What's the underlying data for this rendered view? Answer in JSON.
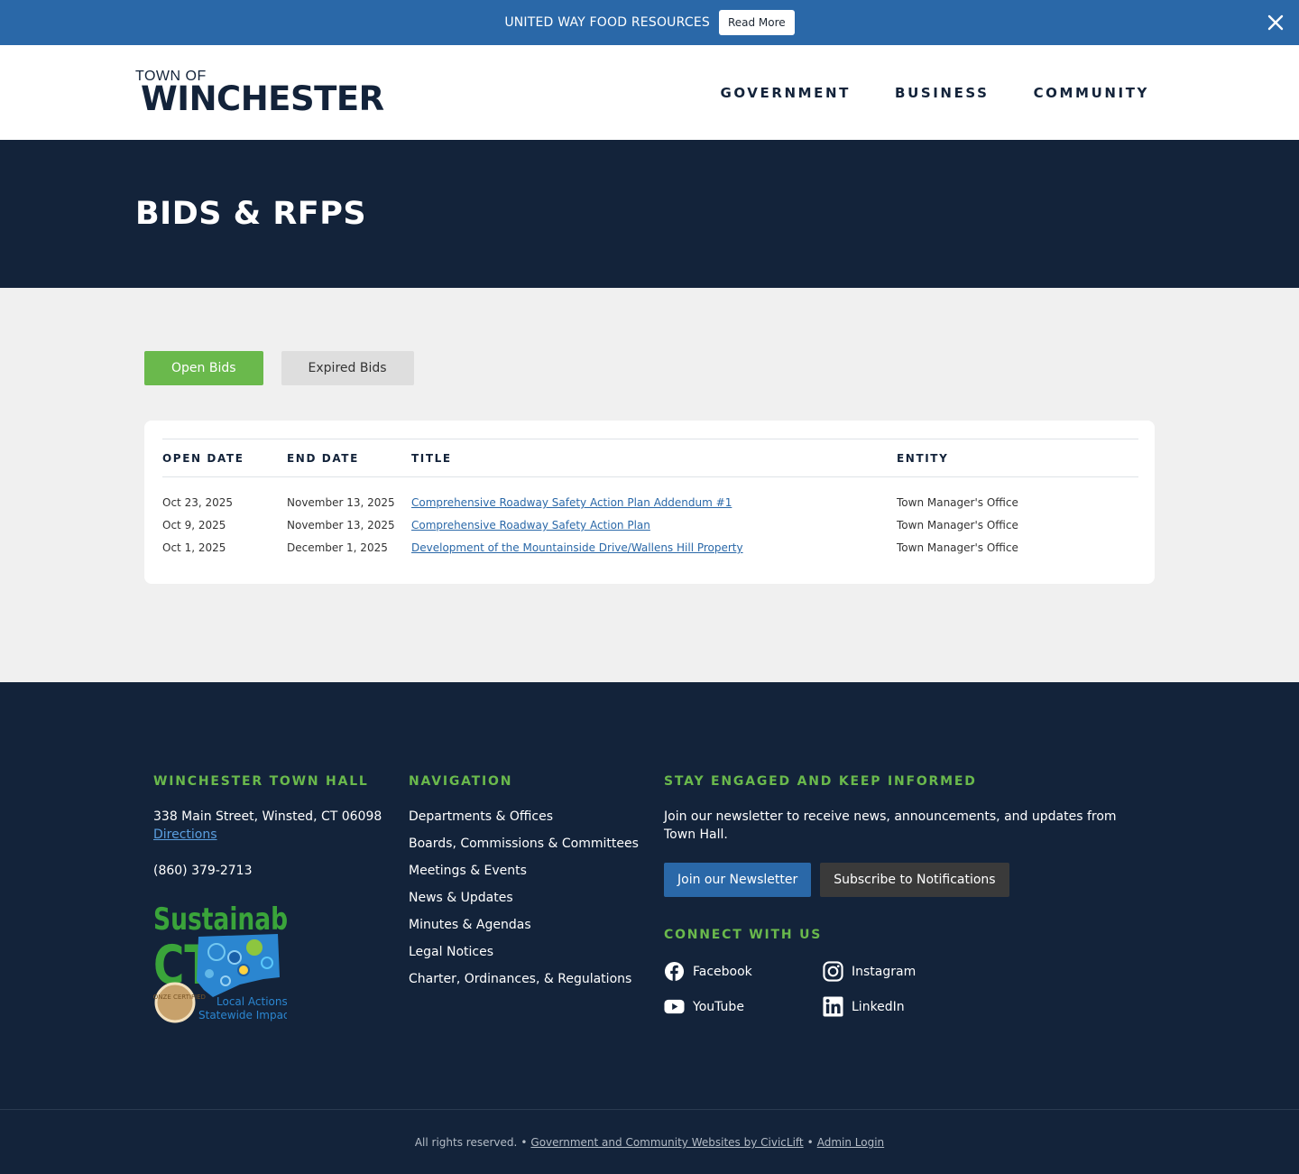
{
  "alert": {
    "text": "UNITED WAY FOOD RESOURCES",
    "button_label": "Read More"
  },
  "header": {
    "logo_top": "TOWN OF",
    "logo_main": "WINCHESTER",
    "nav": [
      "GOVERNMENT",
      "BUSINESS",
      "COMMUNITY"
    ]
  },
  "hero": {
    "title": "BIDS & RFPS"
  },
  "tabs": {
    "open": "Open Bids",
    "expired": "Expired Bids"
  },
  "table": {
    "headers": [
      "OPEN DATE",
      "END DATE",
      "TITLE",
      "ENTITY"
    ],
    "rows": [
      {
        "open": "Oct 23, 2025",
        "end": "November 13, 2025",
        "title": "Comprehensive Roadway Safety Action Plan Addendum #1",
        "entity": "Town Manager's Office"
      },
      {
        "open": "Oct 9, 2025",
        "end": "November 13, 2025",
        "title": "Comprehensive Roadway Safety Action Plan",
        "entity": "Town Manager's Office"
      },
      {
        "open": "Oct 1, 2025",
        "end": "December 1, 2025",
        "title": "Development of the Mountainside Drive/Wallens Hill Property",
        "entity": "Town Manager's Office"
      }
    ]
  },
  "footer": {
    "townhall": {
      "heading": "WINCHESTER TOWN HALL",
      "address": "338 Main Street, Winsted, CT 06098",
      "directions": "Directions",
      "phone": "(860) 379-2713",
      "badge": {
        "line1": "Sustainable",
        "line2": "CT",
        "seal": "BRONZE CERTIFIED",
        "tag1": "Local Actions.",
        "tag2": "Statewide Impact."
      }
    },
    "navigation": {
      "heading": "NAVIGATION",
      "items": [
        "Departments & Offices",
        "Boards, Commissions & Committees",
        "Meetings & Events",
        "News & Updates",
        "Minutes & Agendas",
        "Legal Notices",
        "Charter, Ordinances, & Regulations"
      ]
    },
    "engaged": {
      "heading": "STAY ENGAGED AND KEEP INFORMED",
      "text": "Join our newsletter to receive news, announcements, and updates from Town Hall.",
      "newsletter_button": "Join our Newsletter",
      "notify_button": "Subscribe to Notifications",
      "connect_heading": "CONNECT WITH US",
      "social": [
        {
          "label": "Facebook",
          "icon": "facebook-icon"
        },
        {
          "label": "Instagram",
          "icon": "instagram-icon"
        },
        {
          "label": "YouTube",
          "icon": "youtube-icon"
        },
        {
          "label": "LinkedIn",
          "icon": "linkedin-icon"
        }
      ]
    }
  },
  "bottom": {
    "rights": "All rights reserved.",
    "civiclift": "Government and Community Websites by CivicLift",
    "admin": "Admin Login"
  },
  "colors": {
    "alert_blue": "#2a68a8",
    "navy": "#13233a",
    "green": "#6ab94c"
  }
}
